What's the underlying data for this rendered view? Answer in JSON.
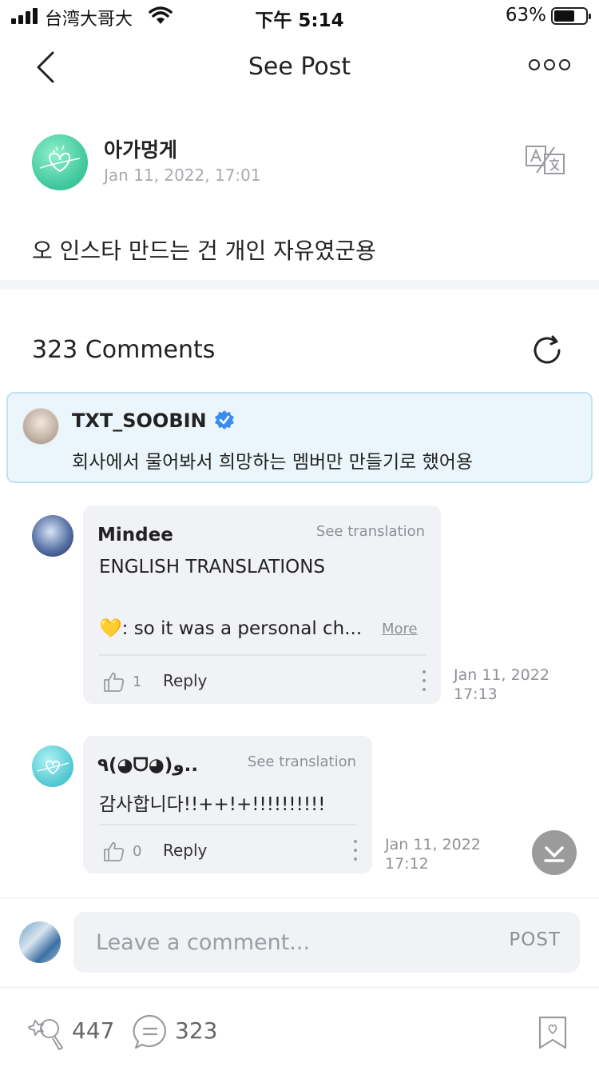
{
  "status": {
    "carrier": "台湾大哥大",
    "time": "下午 5:14",
    "battery": "63%"
  },
  "header": {
    "title": "See Post"
  },
  "post": {
    "author": "아가멍게",
    "date": "Jan 11, 2022, 17:01",
    "body": "오 인스타 만드는 건 개인 자유였군용"
  },
  "comments_section": {
    "count_label": "323 Comments"
  },
  "pinned_comment": {
    "author": "TXT_SOOBIN",
    "text": "회사에서 물어봐서 희망하는 멤버만 만들기로 했어용"
  },
  "comments": [
    {
      "author": "Mindee",
      "see_translation": "See translation",
      "line1": "ENGLISH TRANSLATIONS",
      "line2": "💛: so it was a personal ch...",
      "more": "More",
      "likes": "1",
      "reply": "Reply",
      "date": "Jan 11, 2022",
      "time": "17:13"
    },
    {
      "author": "٩(◕ᗜ◕)و..",
      "see_translation": "See translation",
      "line1": "감사합니다!!++!+!!!!!!!!!!",
      "likes": "0",
      "reply": "Reply",
      "date": "Jan 11, 2022",
      "time": "17:12"
    }
  ],
  "composer": {
    "placeholder": "Leave a comment...",
    "post_label": "POST"
  },
  "footer": {
    "likes": "447",
    "comments": "323"
  },
  "colors": {
    "pinned_bg": "#eaf6fb",
    "verified": "#3b8cf0",
    "avatar_green": "#3cc59a"
  }
}
